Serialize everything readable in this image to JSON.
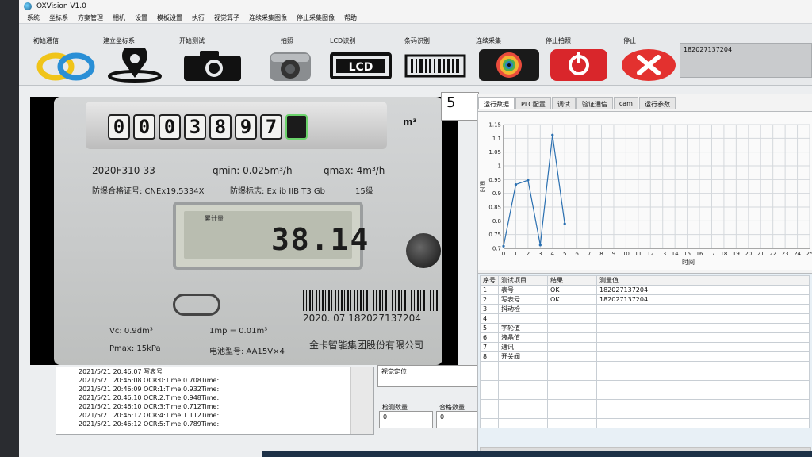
{
  "window": {
    "title": "OXVision V1.0"
  },
  "menu": [
    "系统",
    "坐标系",
    "方案管理",
    "相机",
    "设置",
    "模板设置",
    "执行",
    "视觉算子",
    "连续采集图像",
    "停止采集图像",
    "帮助"
  ],
  "toolbar": {
    "buttons": [
      {
        "label": "初始通信",
        "icon": "rings-icon"
      },
      {
        "label": "建立坐标系",
        "icon": "map-pin-icon"
      },
      {
        "label": "开始测试",
        "icon": "camera-icon"
      },
      {
        "label": "拍照",
        "icon": "lens-camera-icon"
      },
      {
        "label": "LCD识别",
        "icon": "lcd-icon"
      },
      {
        "label": "条码识别",
        "icon": "barcode-icon"
      },
      {
        "label": "连续采集",
        "icon": "aperture-icon"
      },
      {
        "label": "停止拍照",
        "icon": "power-icon"
      },
      {
        "label": "停止",
        "icon": "close-icon"
      }
    ],
    "readout": "182027137204"
  },
  "meter": {
    "digits": [
      "0",
      "0",
      "0",
      "3",
      "8",
      "9",
      "7",
      ""
    ],
    "unit": "m³",
    "model": "2020F310-33",
    "qmin": "qmin: 0.025m³/h",
    "qmax": "qmax: 4m³/h",
    "cert": "防爆合格证号: CNEx19.5334X",
    "explosion_mark": "防爆标志: Ex ib IIB T3 Gb",
    "grade": "15级",
    "lcd_label": "累计量",
    "lcd_value": "38.14",
    "vc": "Vc: 0.9dm³",
    "imp": "1mp = 0.01m³",
    "pmax": "Pmax: 15kPa",
    "battery": "电池型号: AA15V×4",
    "barcode_text": "2020. 07  182027137204",
    "company": "金卡智能集团股份有限公司"
  },
  "count_box": "5",
  "log": [
    "2021/5/21 20:46:07 写表号",
    "2021/5/21 20:46:08 OCR:0:Time:0.708Time:",
    "2021/5/21 20:46:09 OCR:1:Time:0.932Time:",
    "2021/5/21 20:46:10 OCR:2:Time:0.948Time:",
    "2021/5/21 20:46:10 OCR:3:Time:0.712Time:",
    "2021/5/21 20:46:12 OCR:4:Time:1.112Time:",
    "2021/5/21 20:46:12 OCR:5:Time:0.789Time:"
  ],
  "vision": {
    "label": "视觉定位"
  },
  "counters": {
    "detect_label": "检测数量",
    "detect_value": "0",
    "pass_label": "合格数量",
    "pass_value": "0"
  },
  "tabs": [
    "运行数据",
    "PLC配置",
    "调试",
    "验证通信",
    "cam",
    "运行参数"
  ],
  "chart_data": {
    "type": "line",
    "x": [
      0,
      1,
      2,
      3,
      4,
      5
    ],
    "series": [
      {
        "values": [
          0.708,
          0.932,
          0.948,
          0.712,
          1.112,
          0.789
        ]
      }
    ],
    "xlabel": "时间",
    "ylabel": "时间",
    "ylim": [
      0.7,
      1.15
    ],
    "xlim": [
      0,
      25
    ],
    "yticks": [
      "0.7",
      "0.75",
      "0.8",
      "0.85",
      "0.9",
      "0.95",
      "1",
      "1.05",
      "1.1",
      "1.15"
    ],
    "xticks": [
      "0",
      "1",
      "2",
      "3",
      "4",
      "5",
      "6",
      "7",
      "8",
      "9",
      "10",
      "11",
      "12",
      "13",
      "14",
      "15",
      "16",
      "17",
      "18",
      "19",
      "20",
      "21",
      "22",
      "23",
      "24",
      "25"
    ],
    "grid": true,
    "line_color": "#2a6fb0"
  },
  "table": {
    "headers": [
      "序号",
      "测试项目",
      "结果",
      "测量值"
    ],
    "rows": [
      [
        "1",
        "表号",
        "OK",
        "182027137204"
      ],
      [
        "2",
        "写表号",
        "OK",
        "182027137204"
      ],
      [
        "3",
        "抖动检",
        "",
        ""
      ],
      [
        "4",
        "",
        "",
        ""
      ],
      [
        "5",
        "字轮值",
        "",
        ""
      ],
      [
        "6",
        "液晶值",
        "",
        ""
      ],
      [
        "7",
        "通讯",
        "",
        ""
      ],
      [
        "8",
        "开关阀",
        "",
        ""
      ]
    ]
  }
}
